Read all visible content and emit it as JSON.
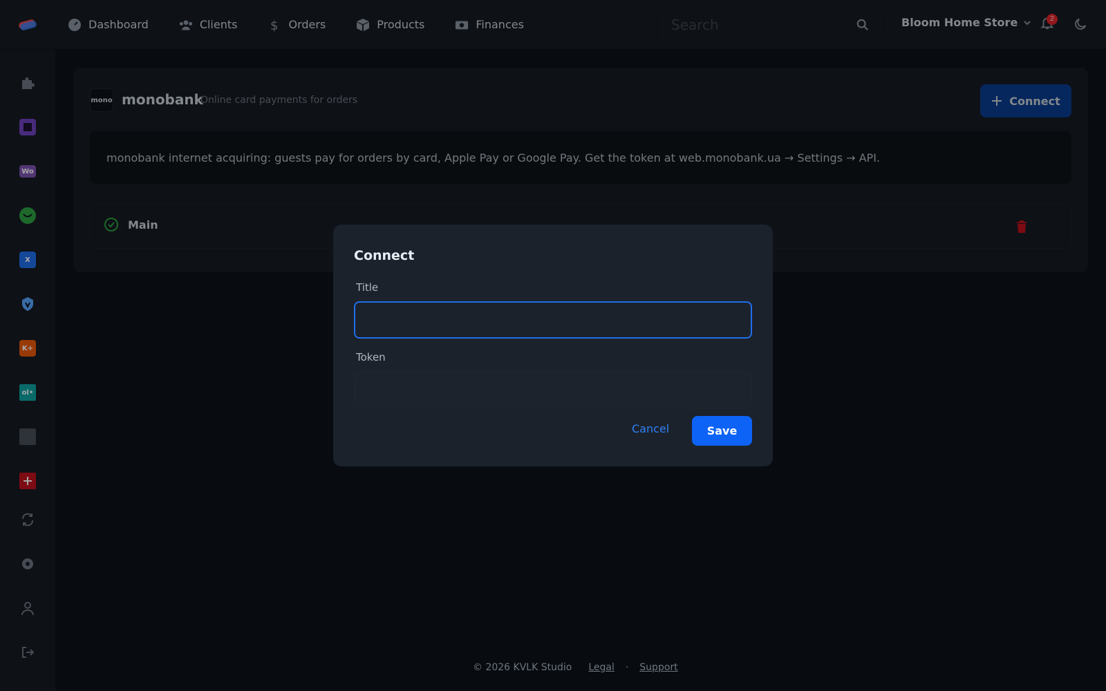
{
  "nav": {
    "items": [
      {
        "label": "Dashboard",
        "icon": "gauge-icon"
      },
      {
        "label": "Clients",
        "icon": "users-icon"
      },
      {
        "label": "Orders",
        "icon": "dollar-icon"
      },
      {
        "label": "Products",
        "icon": "box-icon"
      },
      {
        "label": "Finances",
        "icon": "money-icon"
      }
    ],
    "search_placeholder": "Search",
    "store_name": "Bloom Home Store",
    "notifications_count": "2"
  },
  "sidebar": {
    "items": [
      {
        "icon": "puzzle-icon",
        "color": "#6e7681"
      },
      {
        "icon": "square-app-icon",
        "color": "#6f42c1"
      },
      {
        "icon": "woo-icon",
        "color": "#7f54b3",
        "text": "Wo"
      },
      {
        "icon": "green-app-icon",
        "color": "#2ea043"
      },
      {
        "icon": "x-app-icon",
        "color": "#1f6feb",
        "text": "X"
      },
      {
        "icon": "shield-app-icon",
        "color": "#58a6ff"
      },
      {
        "icon": "kplus-app-icon",
        "color": "#e8590c",
        "text": "K+"
      },
      {
        "icon": "ol-app-icon",
        "color": "#0fa3a3",
        "text": "ol•"
      },
      {
        "icon": "gray-app-icon",
        "color": "#484f58"
      },
      {
        "icon": "red-app-icon",
        "color": "#c1121f"
      },
      {
        "icon": "sync-icon",
        "color": "#6e7681"
      },
      {
        "icon": "gear-icon",
        "color": "#6e7681"
      },
      {
        "icon": "user-icon",
        "color": "#6e7681"
      },
      {
        "icon": "logout-icon",
        "color": "#6e7681"
      }
    ]
  },
  "card": {
    "logo_text": "mono",
    "title": "monobank",
    "subtitle": "Online card payments for orders",
    "connect_label": "Connect",
    "info": "monobank internet acquiring: guests pay for orders by card, Apple Pay or Google Pay. Get the token at web.monobank.ua → Settings → API.",
    "connections": [
      {
        "label": "Main",
        "status": "active"
      }
    ]
  },
  "modal": {
    "title": "Connect",
    "title_label": "Title",
    "title_value": "",
    "token_label": "Token",
    "token_value": "",
    "cancel_label": "Cancel",
    "save_label": "Save"
  },
  "footer": {
    "copyright": "© 2026 KVLK Studio",
    "legal": "Legal",
    "separator": "·",
    "support": "Support"
  },
  "colors": {
    "accent": "#0d63f5",
    "background": "#0d1117",
    "surface": "#161b22",
    "modal": "#1c222c",
    "success": "#2ea043",
    "danger": "#c1121f"
  }
}
